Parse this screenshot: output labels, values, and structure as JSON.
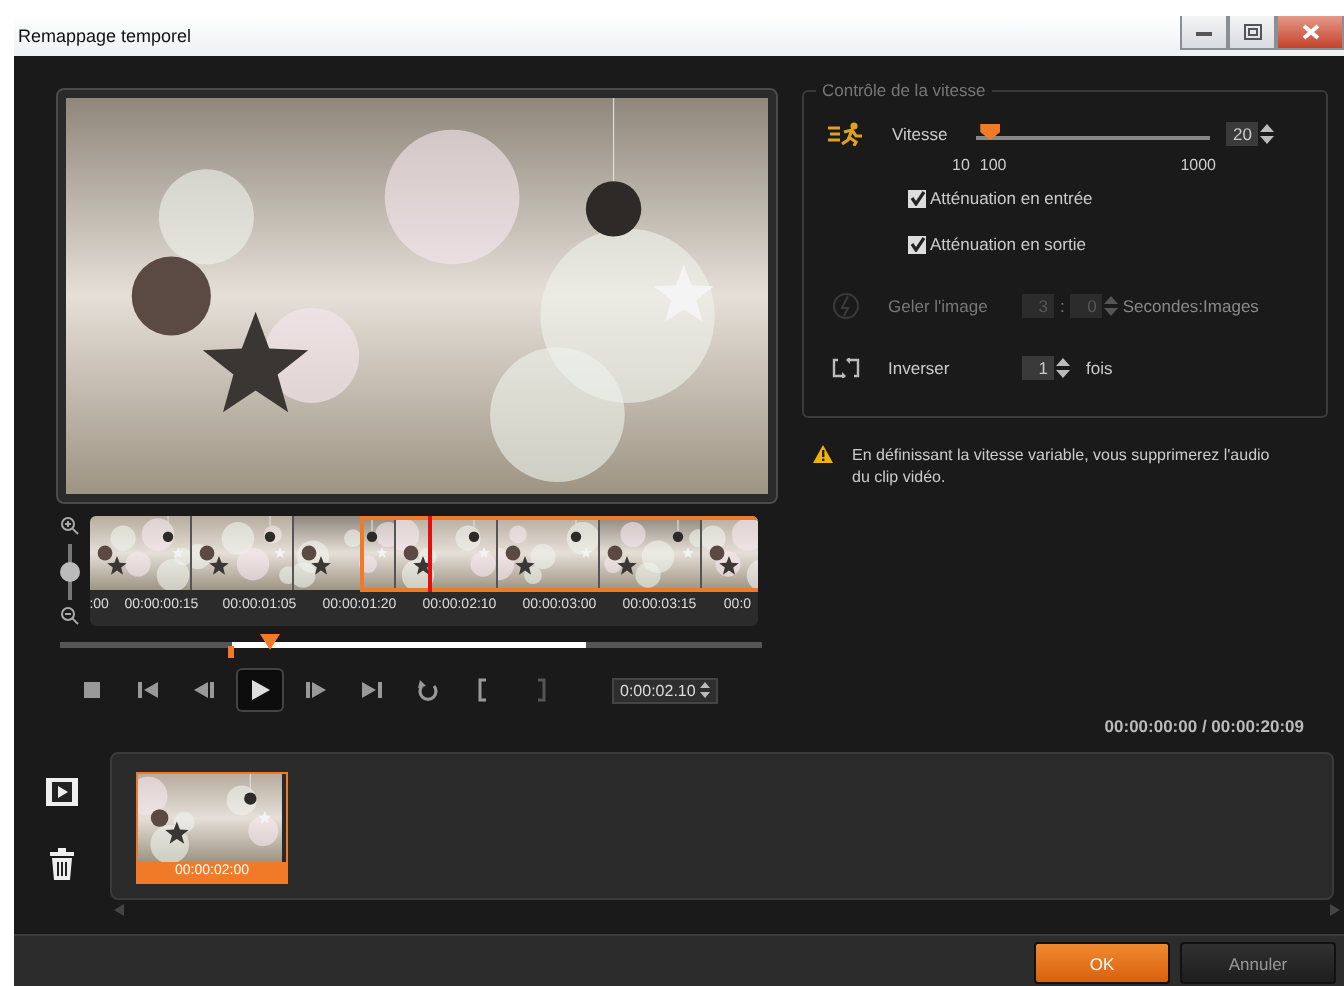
{
  "window": {
    "title": "Remappage temporel"
  },
  "timeline": {
    "zoom_slider": {
      "level": 0.5
    },
    "timecodes": [
      ":00",
      "00:00:00:15",
      "00:00:01:05",
      "00:00:01:20",
      "00:00:02:10",
      "00:00:03:00",
      "00:00:03:15",
      "00:0"
    ]
  },
  "scrubber": {
    "level": 0.3
  },
  "transport": {
    "buttons": [
      {
        "kind": "stop"
      },
      {
        "kind": "start"
      },
      {
        "kind": "prev"
      },
      {
        "kind": "play",
        "selected": true
      },
      {
        "kind": "next"
      },
      {
        "kind": "end"
      },
      {
        "kind": "repeat"
      },
      {
        "kind": "mark_in"
      },
      {
        "kind": "mark_out"
      }
    ],
    "time": "0:00:02.10"
  },
  "speed_control": {
    "title": "Contrôle de la vitesse",
    "speed_label": "Vitesse",
    "speed": {
      "level": 0.02,
      "value": "20",
      "ticks": [
        "10",
        "100",
        "1000"
      ]
    },
    "checkboxes": [
      {
        "label": "Atténuation en entrée",
        "checked": true
      },
      {
        "label": "Atténuation en sortie",
        "checked": true
      }
    ],
    "freeze": {
      "label": "Geler l'image",
      "seconds": "3",
      "separator": ":",
      "frames": "0",
      "unit": "Secondes:Images",
      "disabled": true
    },
    "reverse": {
      "label": "Inverser",
      "count": "1",
      "unit": "fois",
      "disabled": false
    }
  },
  "warning": "En définissant la vitesse variable, vous supprimerez l'audio du clip vidéo.",
  "readout": "00:00:00:00 / 00:00:20:09",
  "tray": {
    "clips": [
      {
        "duration": "00:00:02:00",
        "selected": true
      }
    ]
  },
  "buttons": [
    {
      "label": "OK",
      "kind": "primary"
    },
    {
      "label": "Annuler",
      "kind": "secondary"
    }
  ]
}
